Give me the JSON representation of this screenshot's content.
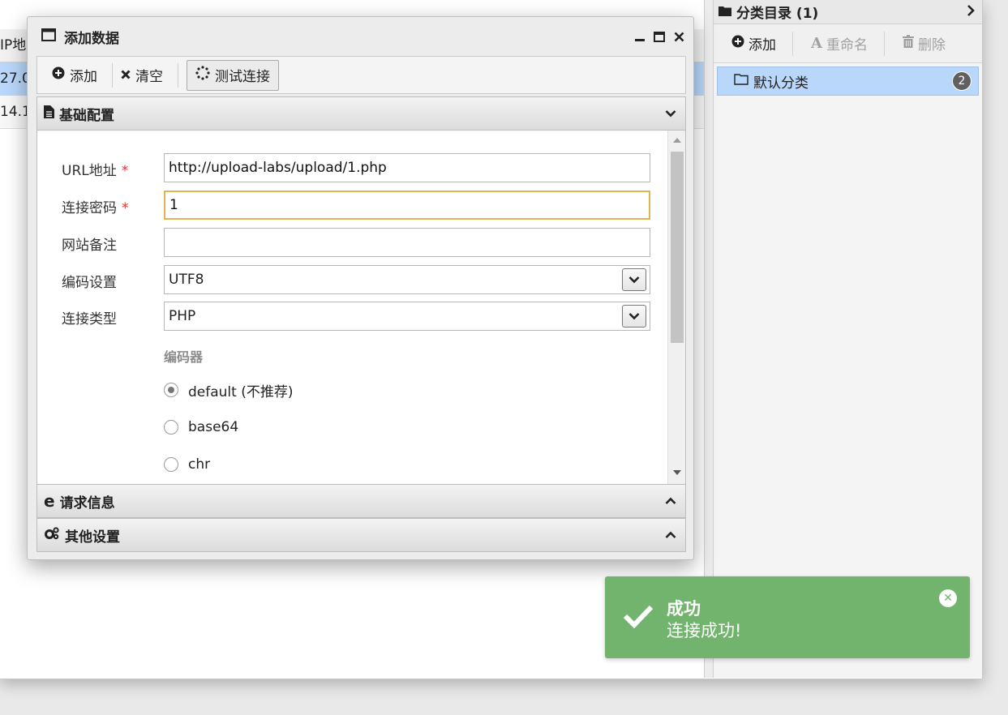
{
  "background": {
    "table_header": "IP地",
    "rows": [
      "27.0",
      "14.1"
    ]
  },
  "sidebar": {
    "title": "分类目录 (1)",
    "toolbar": {
      "add": "添加",
      "rename": "重命名",
      "delete": "删除"
    },
    "tree": [
      {
        "label": "默认分类",
        "count": "2"
      }
    ]
  },
  "dialog": {
    "title": "添加数据",
    "toolbar": {
      "add": "添加",
      "clear": "清空",
      "test": "测试连接"
    },
    "panels": {
      "basic": "基础配置",
      "request": "请求信息",
      "other": "其他设置"
    },
    "form": {
      "url_label": "URL地址",
      "url_value": "http://upload-labs/upload/1.php",
      "password_label": "连接密码",
      "password_value": "1",
      "note_label": "网站备注",
      "note_value": "",
      "encoding_label": "编码设置",
      "encoding_value": "UTF8",
      "type_label": "连接类型",
      "type_value": "PHP",
      "required_mark": "*",
      "encoder_label": "编码器",
      "encoders": [
        {
          "label": "default (不推荐)",
          "checked": true
        },
        {
          "label": "base64",
          "checked": false
        },
        {
          "label": "chr",
          "checked": false
        }
      ]
    }
  },
  "toast": {
    "title": "成功",
    "message": "连接成功!",
    "color": "#72b46e"
  }
}
